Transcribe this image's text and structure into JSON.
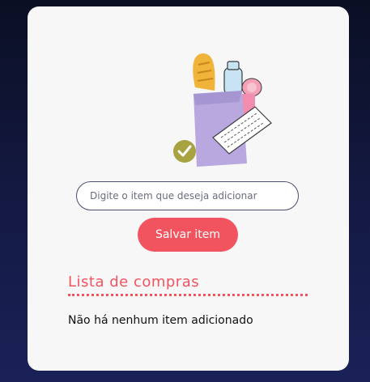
{
  "form": {
    "item_placeholder": "Digite o item que deseja adicionar",
    "save_label": "Salvar item"
  },
  "list": {
    "title": "Lista de compras",
    "empty_message": "Não há nenhum item adicionado"
  },
  "illustration": {
    "icon": "grocery-bag-icon",
    "check_icon": "check-icon"
  },
  "colors": {
    "accent": "#f1545f",
    "bag": "#b9a8df",
    "check_badge": "#a8a240"
  }
}
